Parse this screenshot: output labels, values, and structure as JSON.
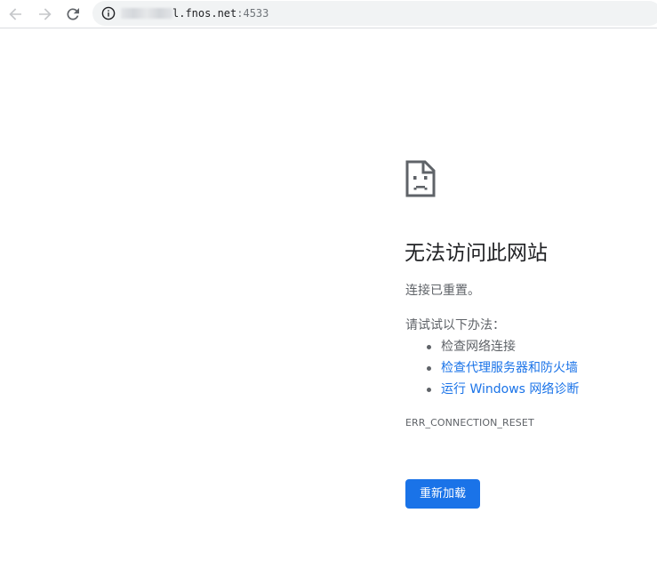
{
  "toolbar": {
    "back_icon": "back-arrow-icon",
    "forward_icon": "forward-arrow-icon",
    "reload_icon": "reload-icon",
    "info_icon": "info-icon",
    "url": {
      "host_visible": "l.fnos.net",
      "port": ":4533"
    }
  },
  "error": {
    "icon": "sad-page-icon",
    "heading": "无法访问此网站",
    "summary": "连接已重置。",
    "suggest_title": "请试试以下办法：",
    "suggestions": [
      {
        "text": "检查网络连接",
        "is_link": false
      },
      {
        "text": "检查代理服务器和防火墙",
        "is_link": true
      },
      {
        "text": "运行 Windows 网络诊断",
        "is_link": true
      }
    ],
    "code": "ERR_CONNECTION_RESET",
    "reload_label": "重新加载"
  },
  "colors": {
    "link": "#1a73e8",
    "button": "#1a73e8",
    "secondary_text": "#5f6368",
    "omnibox_bg": "#f1f3f4"
  }
}
